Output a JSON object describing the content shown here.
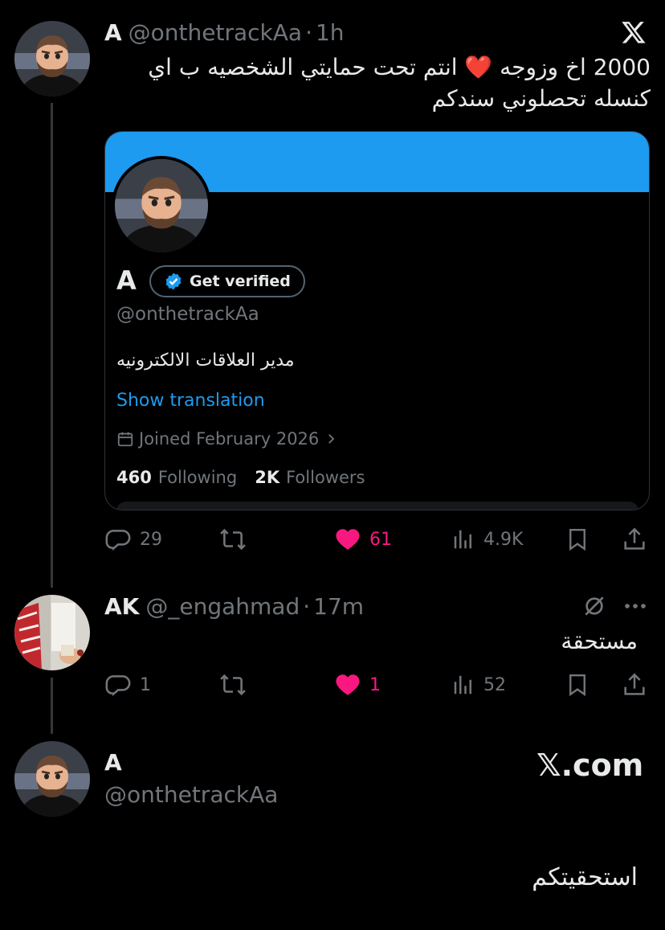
{
  "post1": {
    "name": "A",
    "handle": "@onthetrackAa",
    "dot": "·",
    "time": "1h",
    "text_line1": "2000 اخ وزوجه ❤️ انتم تحت حمايتي الشخصيه ب اي",
    "text_line2": "كنسله تحصلوني سندكم",
    "card": {
      "name": "A",
      "get_verified": "Get verified",
      "handle": "@onthetrackAa",
      "bio": "مدير العلاقات الالكترونيه",
      "show_translation": "Show translation",
      "joined": "Joined February 2026",
      "following_count": "460",
      "following_label": "Following",
      "followers_count": "2K",
      "followers_label": "Followers"
    },
    "stats": {
      "replies": "29",
      "likes": "61",
      "views": "4.9K"
    }
  },
  "post2": {
    "name": "AK",
    "handle": "@_engahmad",
    "dot": "·",
    "time": "17m",
    "text": "مستحقة",
    "stats": {
      "replies": "1",
      "likes": "1",
      "views": "52"
    }
  },
  "post3": {
    "name": "A",
    "handle": "@onthetrackAa",
    "brand": "𝕏.com",
    "text": "استحقيتكم"
  },
  "colors": {
    "background": "#000000",
    "accent_blue": "#1d9bf0",
    "like_pink": "#f91880",
    "muted": "#71767b"
  },
  "icons": [
    "x-logo-icon",
    "reply-icon",
    "repost-icon",
    "heart-icon",
    "views-icon",
    "bookmark-icon",
    "share-icon",
    "verified-badge-icon",
    "calendar-icon",
    "chevron-right-icon",
    "grok-icon",
    "more-icon"
  ]
}
